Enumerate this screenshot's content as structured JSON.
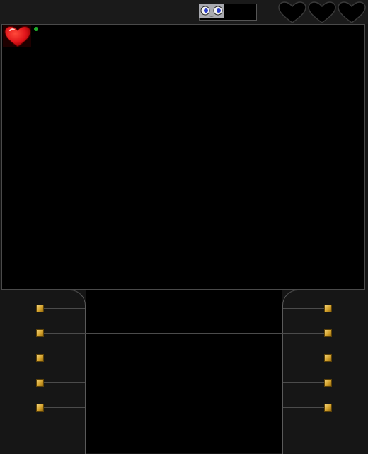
{
  "hud": {
    "lives_total": 3,
    "lives_filled": 0,
    "portrait_icon": "character-face-icon",
    "life_icon": "heart-outline-icon"
  },
  "player": {
    "held_item_icon": "red-heart-icon",
    "status_color": "#1fae2a"
  },
  "colors": {
    "background": "#151515",
    "playfield": "#000000",
    "heart_red": "#e0141a",
    "peg_gold": "#d4a22c"
  },
  "pegs": {
    "rows": 5,
    "long_wire_row": 2
  }
}
